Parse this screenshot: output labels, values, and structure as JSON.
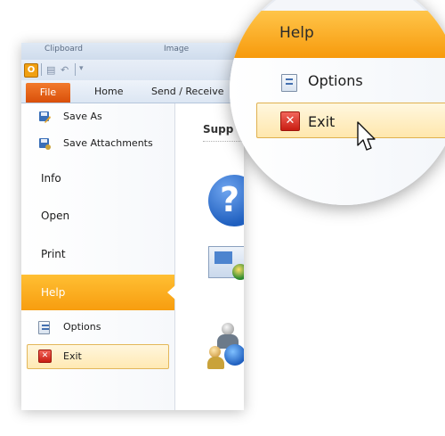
{
  "window": {
    "top_strip": [
      "Clipboard",
      "Image"
    ],
    "tabs": {
      "file": "File",
      "items": [
        "Home",
        "Send / Receive"
      ]
    },
    "backstage": {
      "top_commands": [
        "Save As",
        "Save Attachments"
      ],
      "sections": [
        "Info",
        "Open",
        "Print",
        "Help"
      ],
      "sub_commands": [
        "Options",
        "Exit"
      ]
    },
    "support_heading": "Supp"
  },
  "magnifier": {
    "help": "Help",
    "options": "Options",
    "exit": "Exit"
  },
  "colors": {
    "help_orange": "#f79d0f",
    "file_tab": "#e05a15",
    "exit_highlight": "#ffe9b3",
    "exit_icon": "#c81d12"
  },
  "icons": [
    "outlook-icon",
    "save-icon",
    "undo-icon",
    "save-as-icon",
    "save-attachments-icon",
    "options-icon",
    "exit-icon",
    "help-question-icon",
    "getting-started-icon",
    "contact-us-icon",
    "mouse-pointer-icon"
  ]
}
